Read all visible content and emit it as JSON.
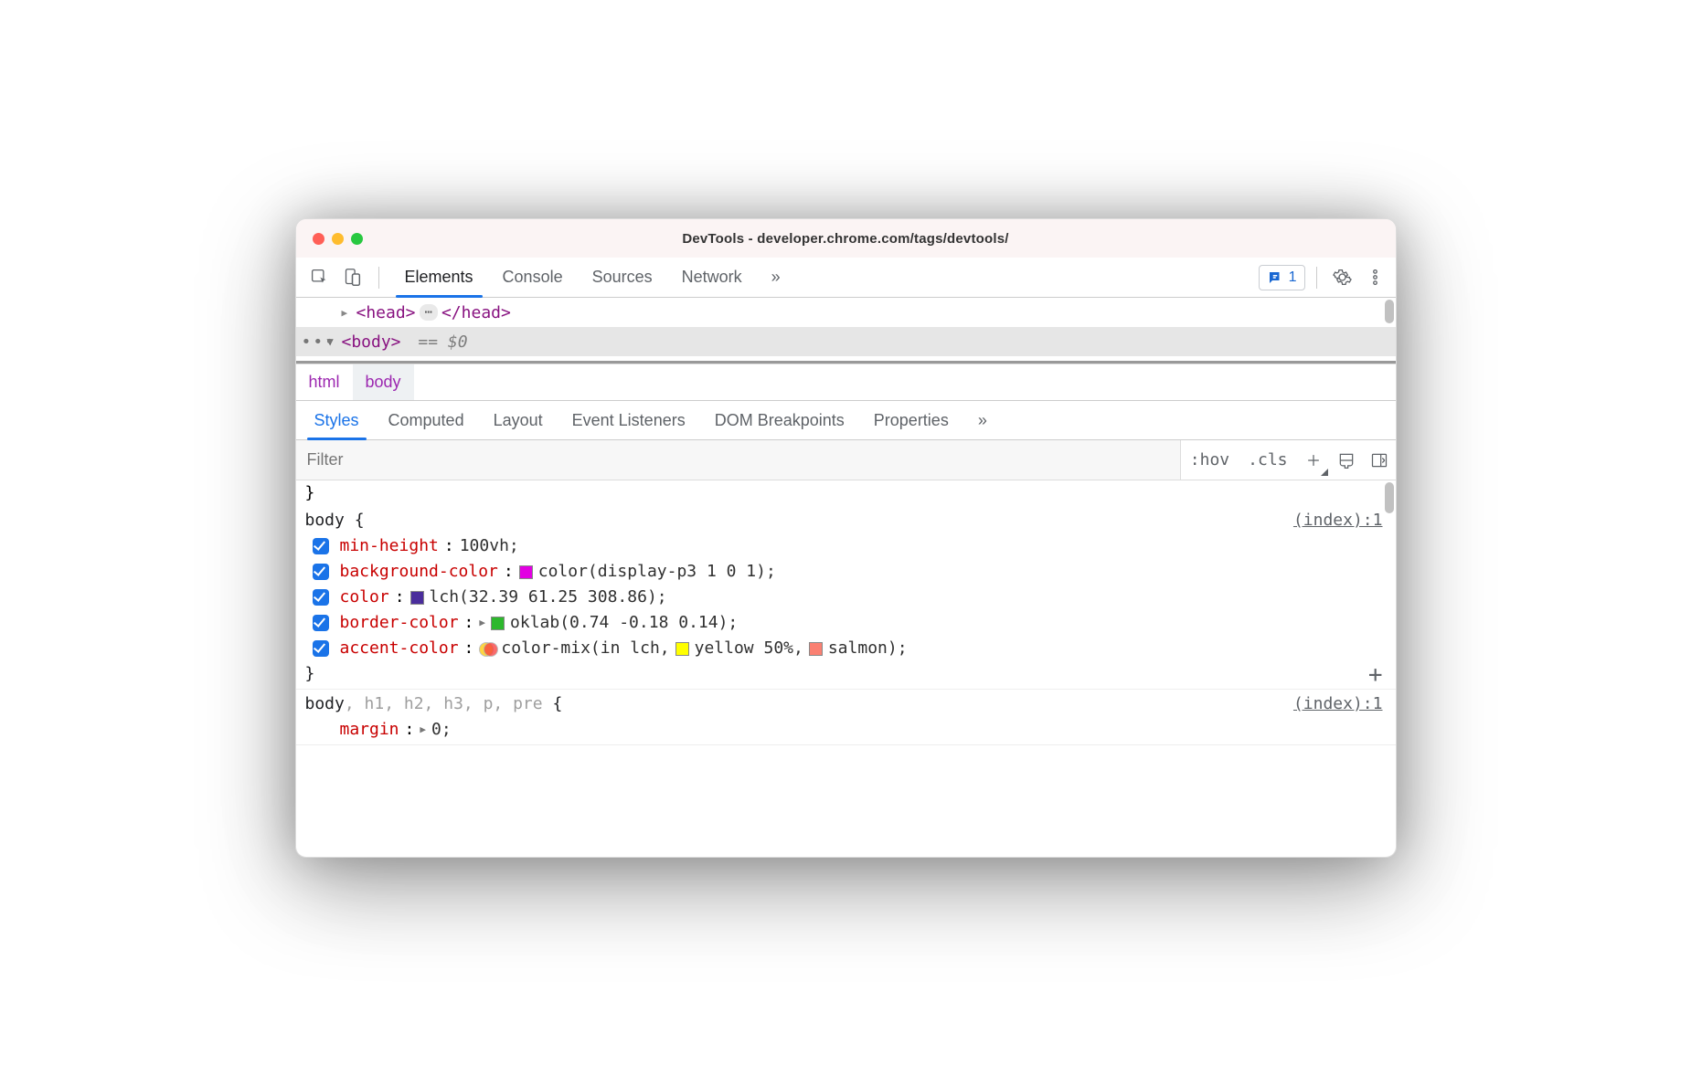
{
  "window": {
    "title": "DevTools - developer.chrome.com/tags/devtools/"
  },
  "toolbar": {
    "tabs": [
      "Elements",
      "Console",
      "Sources",
      "Network"
    ],
    "active_tab_index": 0,
    "overflow_glyph": "»",
    "issues_count": "1"
  },
  "dom": {
    "head_open": "<head>",
    "head_close": "</head>",
    "body_open": "<body>",
    "selected_marker": "== $0",
    "ellipsis_glyph": "⋯",
    "selected_dots": "•••"
  },
  "breadcrumbs": {
    "items": [
      "html",
      "body"
    ],
    "active_index": 1
  },
  "side_tabs": {
    "items": [
      "Styles",
      "Computed",
      "Layout",
      "Event Listeners",
      "DOM Breakpoints",
      "Properties"
    ],
    "active_index": 0,
    "overflow_glyph": "»"
  },
  "filter_row": {
    "placeholder": "Filter",
    "hov": ":hov",
    "cls": ".cls"
  },
  "styles": {
    "closing_brace_fragment": "}",
    "rules": [
      {
        "selector_main": "body",
        "selector_dim": "",
        "source": "(index):1",
        "show_add": true,
        "props": [
          {
            "name": "min-height",
            "value": "100vh",
            "swatches": [],
            "expand": false
          },
          {
            "name": "background-color",
            "value": "color(display-p3 1 0 1)",
            "swatches": [
              {
                "type": "square",
                "color": "#e200e2"
              }
            ],
            "expand": false
          },
          {
            "name": "color",
            "value": "lch(32.39 61.25 308.86)",
            "swatches": [
              {
                "type": "square",
                "color": "#4a2d9c"
              }
            ],
            "expand": false
          },
          {
            "name": "border-color",
            "value": "oklab(0.74 -0.18 0.14)",
            "swatches": [
              {
                "type": "square",
                "color": "#2db82d"
              }
            ],
            "expand": true
          },
          {
            "name": "accent-color",
            "value_parts": [
              "color-mix(in lch, ",
              "yellow 50%, ",
              "salmon)"
            ],
            "mix": true,
            "inline_swatches": [
              {
                "color": "#ffff00"
              },
              {
                "color": "#fa8072"
              }
            ],
            "expand": false
          }
        ]
      },
      {
        "selector_main": "body",
        "selector_dim": ", h1, h2, h3, p, pre",
        "source": "(index):1",
        "show_add": false,
        "props": [
          {
            "name": "margin",
            "value": "0",
            "swatches": [],
            "expand": true,
            "no_check": true
          }
        ],
        "no_close": true
      }
    ]
  }
}
